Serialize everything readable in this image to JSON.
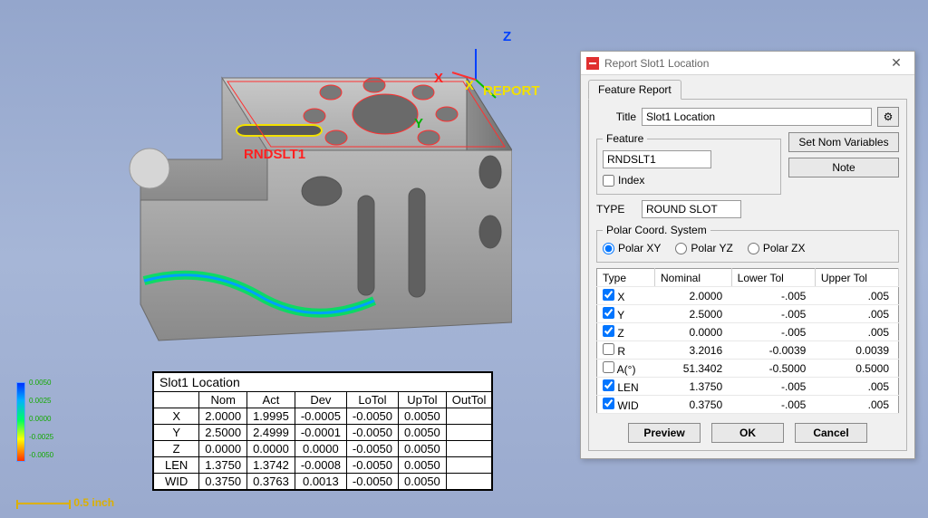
{
  "viewport": {
    "axis_z": "Z",
    "axis_x": "X",
    "axis_y": "Y",
    "axis_x2": "X",
    "report_label": "REPORT",
    "feature_label": "RNDSLT1",
    "scale_label": "0.5 inch"
  },
  "legend": {
    "ticks": [
      "0.0050",
      "0.0025",
      "0.0000",
      "-0.0025",
      "-0.0050"
    ]
  },
  "result_table": {
    "title": "Slot1 Location",
    "headers": [
      "",
      "Nom",
      "Act",
      "Dev",
      "LoTol",
      "UpTol",
      "OutTol"
    ],
    "rows": [
      {
        "label": "X",
        "nom": "2.0000",
        "act": "1.9995",
        "dev": "-0.0005",
        "lo": "-0.0050",
        "up": "0.0050",
        "out": ""
      },
      {
        "label": "Y",
        "nom": "2.5000",
        "act": "2.4999",
        "dev": "-0.0001",
        "lo": "-0.0050",
        "up": "0.0050",
        "out": ""
      },
      {
        "label": "Z",
        "nom": "0.0000",
        "act": "0.0000",
        "dev": "0.0000",
        "lo": "-0.0050",
        "up": "0.0050",
        "out": ""
      },
      {
        "label": "LEN",
        "nom": "1.3750",
        "act": "1.3742",
        "dev": "-0.0008",
        "lo": "-0.0050",
        "up": "0.0050",
        "out": ""
      },
      {
        "label": "WID",
        "nom": "0.3750",
        "act": "0.3763",
        "dev": "0.0013",
        "lo": "-0.0050",
        "up": "0.0050",
        "out": ""
      }
    ]
  },
  "dialog": {
    "title": "Report Slot1 Location",
    "tab": "Feature Report",
    "title_label": "Title",
    "title_value": "Slot1 Location",
    "feature_legend": "Feature",
    "feature_value": "RNDSLT1",
    "index_label": "Index",
    "type_label": "TYPE",
    "type_value": "ROUND SLOT",
    "set_nom_btn": "Set Nom Variables",
    "note_btn": "Note",
    "polar_legend": "Polar Coord. System",
    "polar_options": [
      "Polar XY",
      "Polar YZ",
      "Polar ZX"
    ],
    "tol_headers": [
      "Type",
      "Nominal",
      "Lower Tol",
      "Upper Tol"
    ],
    "tol_rows": [
      {
        "checked": true,
        "type": "X",
        "nom": "2.0000",
        "lo": "-.005",
        "up": ".005"
      },
      {
        "checked": true,
        "type": "Y",
        "nom": "2.5000",
        "lo": "-.005",
        "up": ".005"
      },
      {
        "checked": true,
        "type": "Z",
        "nom": "0.0000",
        "lo": "-.005",
        "up": ".005"
      },
      {
        "checked": false,
        "type": "R",
        "nom": "3.2016",
        "lo": "-0.0039",
        "up": "0.0039"
      },
      {
        "checked": false,
        "type": "A(°)",
        "nom": "51.3402",
        "lo": "-0.5000",
        "up": "0.5000"
      },
      {
        "checked": true,
        "type": "LEN",
        "nom": "1.3750",
        "lo": "-.005",
        "up": ".005"
      },
      {
        "checked": true,
        "type": "WID",
        "nom": "0.3750",
        "lo": "-.005",
        "up": ".005"
      }
    ],
    "preview_btn": "Preview",
    "ok_btn": "OK",
    "cancel_btn": "Cancel"
  }
}
